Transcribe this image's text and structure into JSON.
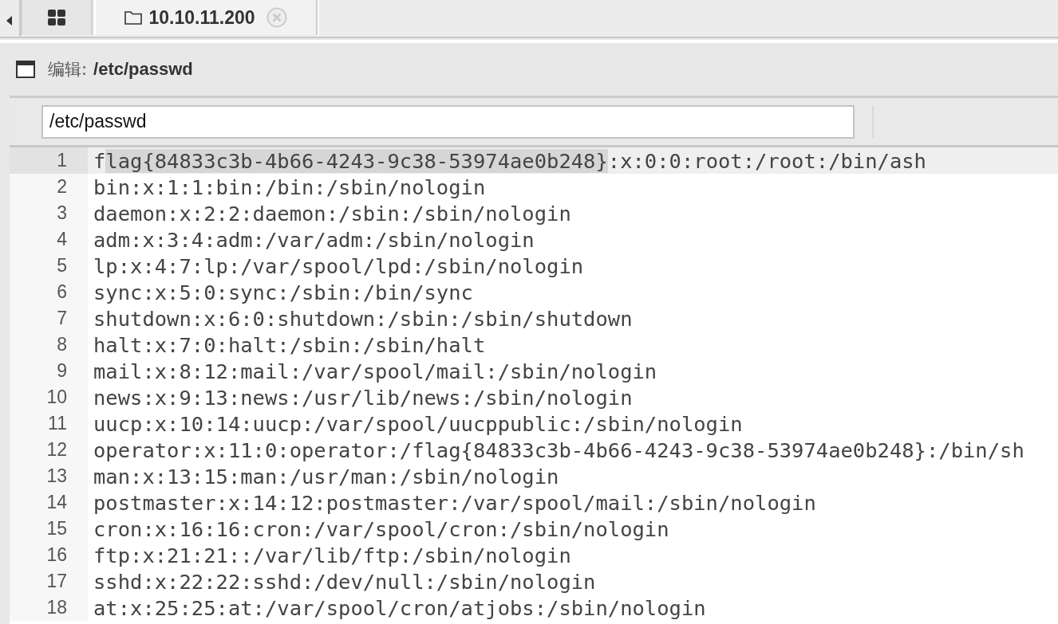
{
  "tabs": [
    {
      "kind": "grid",
      "selected": false
    },
    {
      "kind": "folder",
      "label": "10.10.11.200",
      "selected": true,
      "closable": true
    }
  ],
  "panel": {
    "label": "编辑:",
    "path": "/etc/passwd"
  },
  "path_field": {
    "value": "/etc/passwd"
  },
  "editor": {
    "lines": [
      {
        "number": "1",
        "active": true,
        "parts": [
          {
            "text": "f",
            "selected": false
          },
          {
            "text": "lag{84833c3b-4b66-4243-9c38-53974ae0b248}",
            "selected": true
          },
          {
            "text": ":x:0:0:root:/root:/bin/ash",
            "selected": false
          }
        ]
      },
      {
        "number": "2",
        "active": false,
        "parts": [
          {
            "text": "bin:x:1:1:bin:/bin:/sbin/nologin",
            "selected": false
          }
        ]
      },
      {
        "number": "3",
        "active": false,
        "parts": [
          {
            "text": "daemon:x:2:2:daemon:/sbin:/sbin/nologin",
            "selected": false
          }
        ]
      },
      {
        "number": "4",
        "active": false,
        "parts": [
          {
            "text": "adm:x:3:4:adm:/var/adm:/sbin/nologin",
            "selected": false
          }
        ]
      },
      {
        "number": "5",
        "active": false,
        "parts": [
          {
            "text": "lp:x:4:7:lp:/var/spool/lpd:/sbin/nologin",
            "selected": false
          }
        ]
      },
      {
        "number": "6",
        "active": false,
        "parts": [
          {
            "text": "sync:x:5:0:sync:/sbin:/bin/sync",
            "selected": false
          }
        ]
      },
      {
        "number": "7",
        "active": false,
        "parts": [
          {
            "text": "shutdown:x:6:0:shutdown:/sbin:/sbin/shutdown",
            "selected": false
          }
        ]
      },
      {
        "number": "8",
        "active": false,
        "parts": [
          {
            "text": "halt:x:7:0:halt:/sbin:/sbin/halt",
            "selected": false
          }
        ]
      },
      {
        "number": "9",
        "active": false,
        "parts": [
          {
            "text": "mail:x:8:12:mail:/var/spool/mail:/sbin/nologin",
            "selected": false
          }
        ]
      },
      {
        "number": "10",
        "active": false,
        "parts": [
          {
            "text": "news:x:9:13:news:/usr/lib/news:/sbin/nologin",
            "selected": false
          }
        ]
      },
      {
        "number": "11",
        "active": false,
        "parts": [
          {
            "text": "uucp:x:10:14:uucp:/var/spool/uucppublic:/sbin/nologin",
            "selected": false
          }
        ]
      },
      {
        "number": "12",
        "active": false,
        "parts": [
          {
            "text": "operator:x:11:0:operator:/flag{84833c3b-4b66-4243-9c38-53974ae0b248}:/bin/sh",
            "selected": false
          }
        ]
      },
      {
        "number": "13",
        "active": false,
        "parts": [
          {
            "text": "man:x:13:15:man:/usr/man:/sbin/nologin",
            "selected": false
          }
        ]
      },
      {
        "number": "14",
        "active": false,
        "parts": [
          {
            "text": "postmaster:x:14:12:postmaster:/var/spool/mail:/sbin/nologin",
            "selected": false
          }
        ]
      },
      {
        "number": "15",
        "active": false,
        "parts": [
          {
            "text": "cron:x:16:16:cron:/var/spool/cron:/sbin/nologin",
            "selected": false
          }
        ]
      },
      {
        "number": "16",
        "active": false,
        "parts": [
          {
            "text": "ftp:x:21:21::/var/lib/ftp:/sbin/nologin",
            "selected": false
          }
        ]
      },
      {
        "number": "17",
        "active": false,
        "parts": [
          {
            "text": "sshd:x:22:22:sshd:/dev/null:/sbin/nologin",
            "selected": false
          }
        ]
      },
      {
        "number": "18",
        "active": false,
        "parts": [
          {
            "text": "at:x:25:25:at:/var/spool/cron/atjobs:/sbin/nologin",
            "selected": false
          }
        ]
      }
    ]
  }
}
